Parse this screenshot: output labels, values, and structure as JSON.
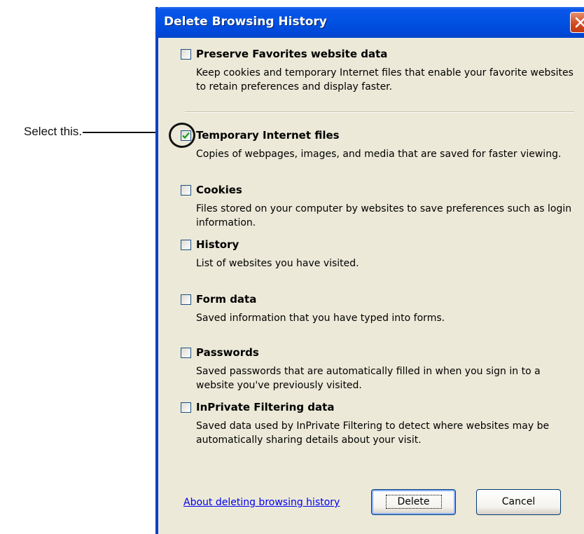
{
  "callout": {
    "text": "Select this."
  },
  "dialog": {
    "title": "Delete Browsing History",
    "options": [
      {
        "label": "Preserve Favorites website data",
        "checked": false,
        "description": "Keep cookies and temporary Internet files that enable your favorite websites to retain preferences and display faster."
      },
      {
        "label": "Temporary Internet files",
        "checked": true,
        "description": "Copies of webpages, images, and media that are saved for faster viewing."
      },
      {
        "label": "Cookies",
        "checked": false,
        "description": "Files stored on your computer by websites to save preferences such as login information."
      },
      {
        "label": "History",
        "checked": false,
        "description": "List of websites you have visited."
      },
      {
        "label": "Form data",
        "checked": false,
        "description": "Saved information that you have typed into forms."
      },
      {
        "label": "Passwords",
        "checked": false,
        "description": "Saved passwords that are automatically filled in when you sign in to a website you've previously visited."
      },
      {
        "label": "InPrivate Filtering data",
        "checked": false,
        "description": "Saved data used by InPrivate Filtering to detect where websites may be automatically sharing details about your visit."
      }
    ],
    "about_link": "About deleting browsing history",
    "delete_label": "Delete",
    "cancel_label": "Cancel"
  },
  "colors": {
    "titlebar": "#0051e2",
    "dialog_bg": "#ece9d8",
    "check_mark": "#21a121",
    "close_button": "#d0461e",
    "link": "#0000ee"
  },
  "icons": {
    "close": "close-icon",
    "check": "checkmark-icon"
  }
}
